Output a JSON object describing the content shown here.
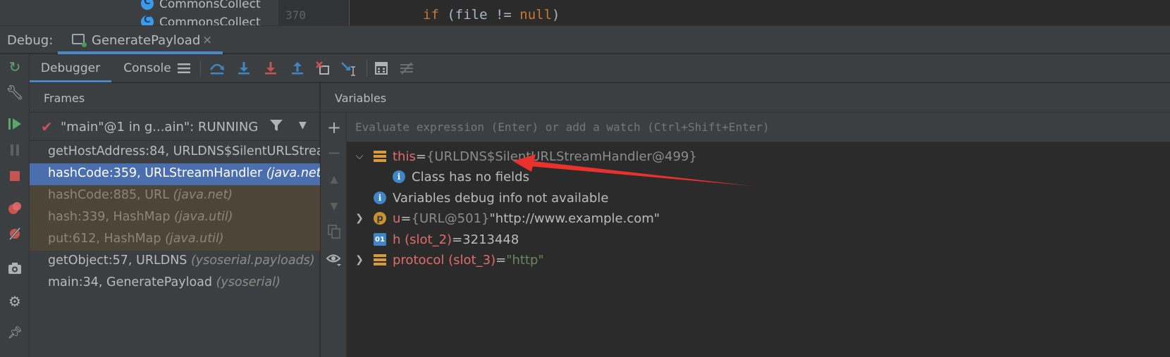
{
  "editor": {
    "tree_items": [
      "CommonsCollect",
      "CommonsCollect"
    ],
    "line_number": "370",
    "code_kw_if": "if",
    "code_mid": " (file != ",
    "code_kw_null": "null",
    "code_end": ")"
  },
  "debug_bar": {
    "label": "Debug:",
    "tab_label": "GeneratePayload",
    "tab_close": "×"
  },
  "sub_toolbar": {
    "tabs": [
      "Debugger",
      "Console"
    ],
    "icons": [
      "layout-icon",
      "step-over-icon",
      "step-into-icon",
      "force-step-into-icon",
      "step-out-icon",
      "drop-frame-icon",
      "run-to-cursor-icon",
      "evaluate-icon",
      "trace-icon"
    ]
  },
  "left_toolbar": {
    "icons": [
      "rerun-icon",
      "settings-wrench-icon",
      "resume-icon",
      "pause-icon",
      "stop-icon",
      "view-breakpoints-icon",
      "mute-breakpoints-icon",
      "camera-icon",
      "gear-icon",
      "pin-icon"
    ]
  },
  "frames": {
    "title": "Frames",
    "thread": "\"main\"@1 in g...ain\": RUNNING",
    "items": [
      {
        "method": "getHostAddress:84, URLDNS$SilentURLStrea",
        "pkg": "",
        "state": "normal"
      },
      {
        "method": "hashCode:359, URLStreamHandler ",
        "pkg": "(java.net)",
        "state": "selected"
      },
      {
        "method": "hashCode:885, URL ",
        "pkg": "(java.net)",
        "state": "lib"
      },
      {
        "method": "hash:339, HashMap ",
        "pkg": "(java.util)",
        "state": "lib"
      },
      {
        "method": "put:612, HashMap ",
        "pkg": "(java.util)",
        "state": "lib"
      },
      {
        "method": "getObject:57, URLDNS ",
        "pkg": "(ysoserial.payloads)",
        "state": "normal"
      },
      {
        "method": "main:34, GeneratePayload ",
        "pkg": "(ysoserial)",
        "state": "normal"
      }
    ]
  },
  "variables": {
    "title": "Variables",
    "eval_placeholder": "Evaluate expression (Enter) or add a watch (Ctrl+Shift+Enter)",
    "rows": {
      "this_name": "this",
      "this_eq": " = ",
      "this_value": "{URLDNS$SilentURLStreamHandler@499}",
      "no_fields": "Class has no fields",
      "no_debug_info": "Variables debug info not available",
      "u_name": "u",
      "u_eq": " = ",
      "u_type": "{URL@501} ",
      "u_value": "\"http://www.example.com\"",
      "h_name": "h (slot_2)",
      "h_eq": " = ",
      "h_value": "3213448",
      "protocol_name": "protocol (slot_3)",
      "protocol_eq": " = ",
      "protocol_value": "\"http\""
    }
  },
  "colors": {
    "selected_frame": "#4b6eaf",
    "library_frame": "#4d4638",
    "annotation_arrow": "#e8322b"
  }
}
